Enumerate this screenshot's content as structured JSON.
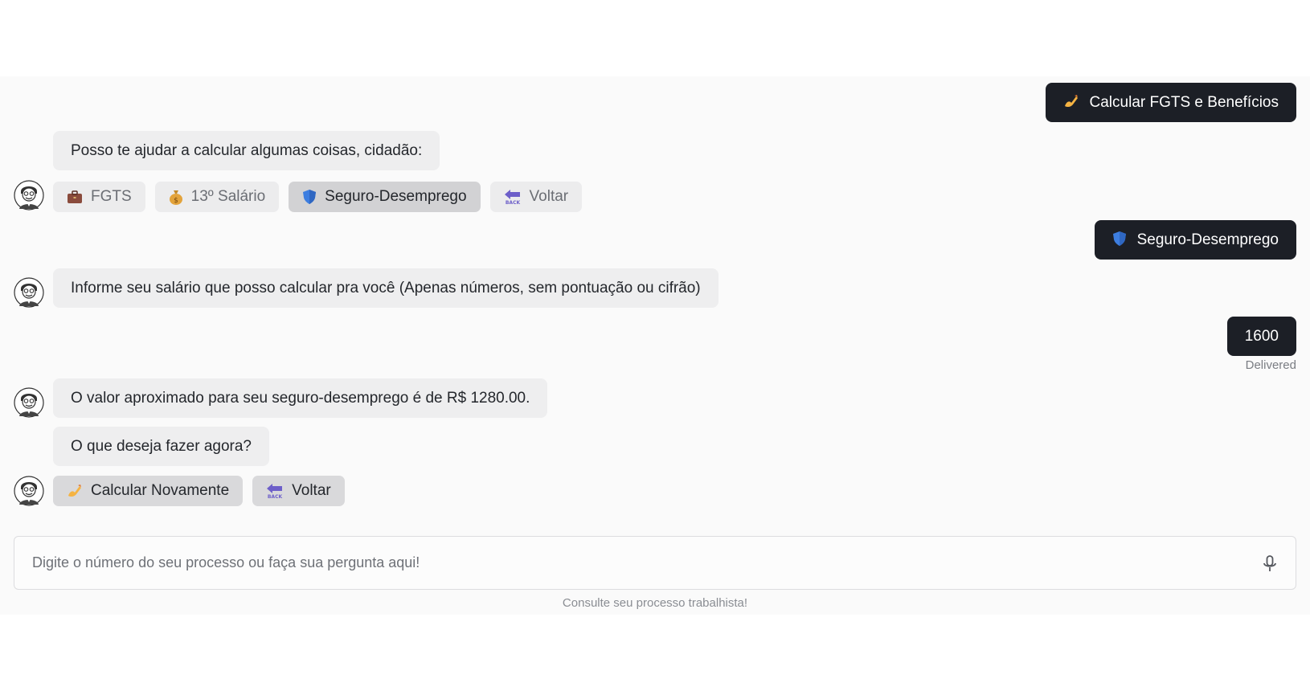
{
  "messages": {
    "user_1": {
      "emoji": "✍️",
      "text": "Calcular FGTS e Benefícios"
    },
    "bot_1": {
      "text": "Posso te ajudar a calcular algumas coisas, cidadão:"
    },
    "options_1": [
      {
        "icon": "briefcase-icon",
        "label": "FGTS"
      },
      {
        "icon": "money-bag-icon",
        "label": "13º Salário"
      },
      {
        "icon": "shield-icon",
        "label": "Seguro-Desemprego"
      },
      {
        "icon": "back-arrow-icon",
        "label": "Voltar"
      }
    ],
    "user_2": {
      "emoji": "🛡️",
      "text": "Seguro-Desemprego"
    },
    "bot_2": {
      "text": "Informe seu salário que posso calcular pra você (Apenas números, sem pontuação ou cifrão)"
    },
    "user_3": {
      "text": "1600",
      "status": "Delivered"
    },
    "bot_3": {
      "text": "O valor aproximado para seu seguro-desemprego é de R$ 1280.00."
    },
    "bot_4": {
      "text": "O que deseja fazer agora?"
    },
    "options_2": [
      {
        "icon": "writing-hand-icon",
        "label": "Calcular Novamente"
      },
      {
        "icon": "back-arrow-icon",
        "label": "Voltar"
      }
    ]
  },
  "composer": {
    "placeholder": "Digite o número do seu processo ou faça sua pergunta aqui!",
    "footer": "Consulte seu processo trabalhista!"
  },
  "colors": {
    "user_bubble": "#1c1f26",
    "bot_bubble": "#eeeeef",
    "panel_bg": "#fafafa"
  }
}
